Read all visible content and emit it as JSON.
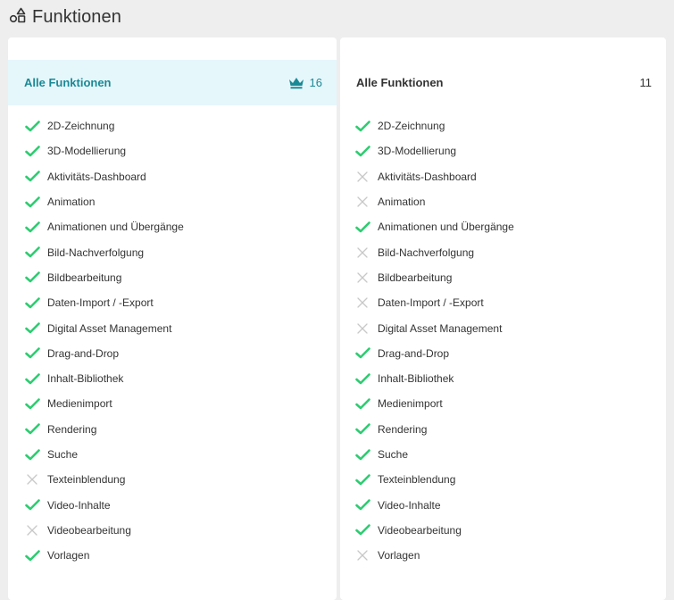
{
  "header": {
    "title": "Funktionen",
    "icon": "shapes-icon"
  },
  "colors": {
    "check": "#2ecc71",
    "cross": "#c8c8c8",
    "accent": "#1a8996",
    "highlight": "#e6f7fb"
  },
  "columns": [
    {
      "title": "Alle Funktionen",
      "count": "16",
      "icon": "crown-icon",
      "features": [
        {
          "label": "2D-Zeichnung",
          "available": true
        },
        {
          "label": "3D-Modellierung",
          "available": true
        },
        {
          "label": "Aktivitäts-Dashboard",
          "available": true
        },
        {
          "label": "Animation",
          "available": true
        },
        {
          "label": "Animationen und Übergänge",
          "available": true
        },
        {
          "label": "Bild-Nachverfolgung",
          "available": true
        },
        {
          "label": "Bildbearbeitung",
          "available": true
        },
        {
          "label": "Daten-Import / -Export",
          "available": true
        },
        {
          "label": "Digital Asset Management",
          "available": true
        },
        {
          "label": "Drag-and-Drop",
          "available": true
        },
        {
          "label": "Inhalt-Bibliothek",
          "available": true
        },
        {
          "label": "Medienimport",
          "available": true
        },
        {
          "label": "Rendering",
          "available": true
        },
        {
          "label": "Suche",
          "available": true
        },
        {
          "label": "Texteinblendung",
          "available": false
        },
        {
          "label": "Video-Inhalte",
          "available": true
        },
        {
          "label": "Videobearbeitung",
          "available": false
        },
        {
          "label": "Vorlagen",
          "available": true
        }
      ]
    },
    {
      "title": "Alle Funktionen",
      "count": "11",
      "features": [
        {
          "label": "2D-Zeichnung",
          "available": true
        },
        {
          "label": "3D-Modellierung",
          "available": true
        },
        {
          "label": "Aktivitäts-Dashboard",
          "available": false
        },
        {
          "label": "Animation",
          "available": false
        },
        {
          "label": "Animationen und Übergänge",
          "available": true
        },
        {
          "label": "Bild-Nachverfolgung",
          "available": false
        },
        {
          "label": "Bildbearbeitung",
          "available": false
        },
        {
          "label": "Daten-Import / -Export",
          "available": false
        },
        {
          "label": "Digital Asset Management",
          "available": false
        },
        {
          "label": "Drag-and-Drop",
          "available": true
        },
        {
          "label": "Inhalt-Bibliothek",
          "available": true
        },
        {
          "label": "Medienimport",
          "available": true
        },
        {
          "label": "Rendering",
          "available": true
        },
        {
          "label": "Suche",
          "available": true
        },
        {
          "label": "Texteinblendung",
          "available": true
        },
        {
          "label": "Video-Inhalte",
          "available": true
        },
        {
          "label": "Videobearbeitung",
          "available": true
        },
        {
          "label": "Vorlagen",
          "available": false
        }
      ]
    }
  ]
}
